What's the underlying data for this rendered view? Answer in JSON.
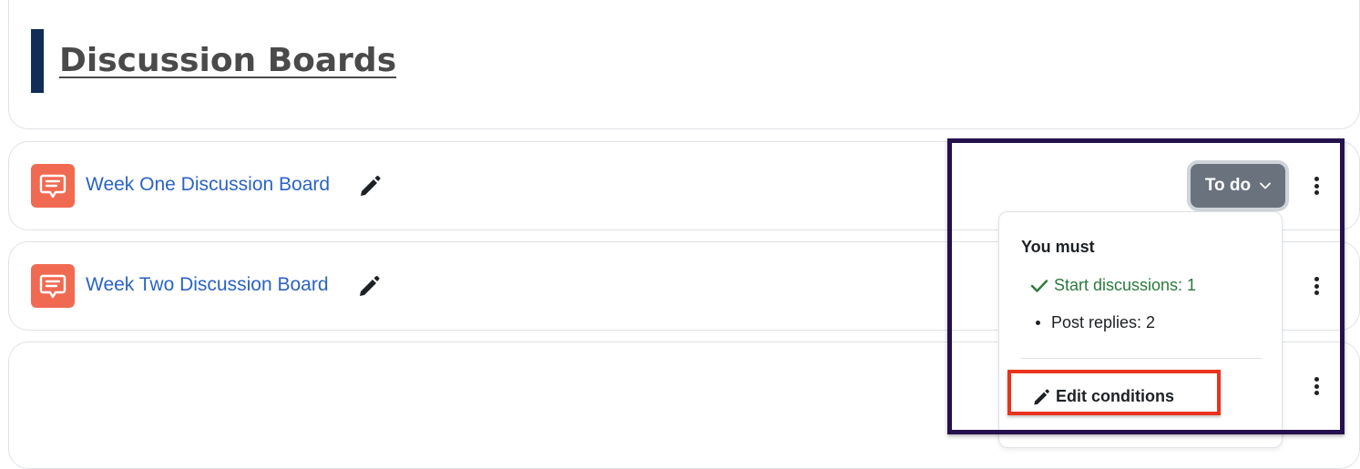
{
  "page": {
    "title": "Discussion Boards"
  },
  "activities": [
    {
      "name": "Week One Discussion Board",
      "icon": "forum-icon"
    },
    {
      "name": "Week Two Discussion Board",
      "icon": "forum-icon"
    }
  ],
  "completion": {
    "status_label": "To do",
    "popover": {
      "heading": "You must",
      "conditions": [
        {
          "label": "Start discussions: 1",
          "status": "complete",
          "icon": "check-icon"
        },
        {
          "label": "Post replies: 2",
          "status": "pending",
          "icon": "bullet"
        }
      ],
      "edit_label": "Edit conditions",
      "edit_icon": "pencil-icon"
    }
  },
  "colors": {
    "title_accent": "#0f2d57",
    "forum_icon_bg": "#f06a52",
    "link": "#2b63c4",
    "complete": "#2b7a3d",
    "todo_button": "#6a737d",
    "highlight_outer": "#25114d",
    "highlight_inner": "#e8341c"
  }
}
